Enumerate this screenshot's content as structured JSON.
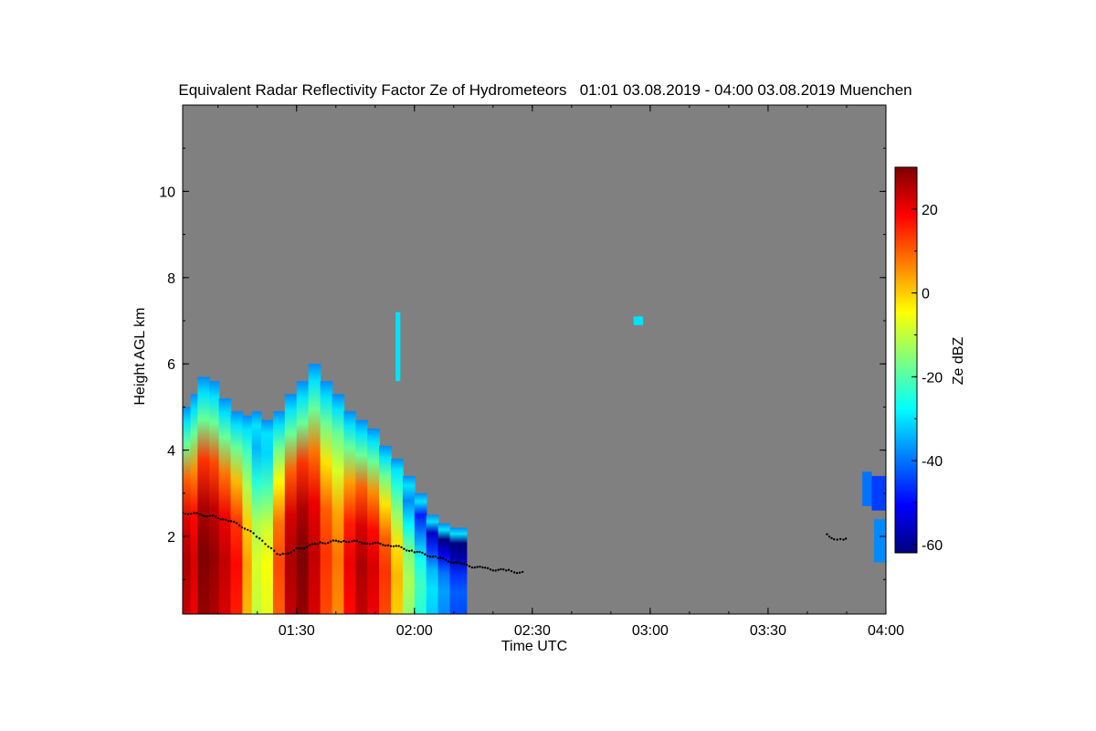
{
  "chart_data": {
    "type": "heatmap",
    "title": "Equivalent Radar Reflectivity Factor Ze of Hydrometeors   01:01 03.08.2019 - 04:00 03.08.2019 Muenchen",
    "xlabel": "Time UTC",
    "ylabel": "Height AGL km",
    "x_range_hours": [
      1.0167,
      4.0
    ],
    "y_range_km": [
      0.2,
      12.0
    ],
    "x_ticks": [
      {
        "value": 1.5,
        "label": "01:30"
      },
      {
        "value": 2.0,
        "label": "02:00"
      },
      {
        "value": 2.5,
        "label": "02:30"
      },
      {
        "value": 3.0,
        "label": "03:00"
      },
      {
        "value": 3.5,
        "label": "03:30"
      },
      {
        "value": 4.0,
        "label": "04:00"
      }
    ],
    "y_ticks": [
      {
        "value": 2,
        "label": "2"
      },
      {
        "value": 4,
        "label": "4"
      },
      {
        "value": 6,
        "label": "6"
      },
      {
        "value": 8,
        "label": "8"
      },
      {
        "value": 10,
        "label": "10"
      }
    ],
    "colorbar": {
      "label": "Ze dBZ",
      "range": [
        -62,
        30
      ],
      "ticks": [
        {
          "value": 20,
          "label": "20"
        },
        {
          "value": 0,
          "label": "0"
        },
        {
          "value": -20,
          "label": "-20"
        },
        {
          "value": -40,
          "label": "-40"
        },
        {
          "value": -60,
          "label": "-60"
        }
      ],
      "colors": [
        "#00007f",
        "#0000ff",
        "#007fff",
        "#00ffff",
        "#7fff7f",
        "#ffff00",
        "#ff7f00",
        "#ff0000",
        "#7f0000"
      ]
    },
    "background_color": "#808080",
    "echo_top_profile_km": [
      [
        1.0167,
        5.1
      ],
      [
        1.05,
        5.3
      ],
      [
        1.1,
        5.6
      ],
      [
        1.13,
        5.9
      ],
      [
        1.17,
        5.7
      ],
      [
        1.22,
        5.4
      ],
      [
        1.27,
        5.1
      ],
      [
        1.31,
        5.0
      ],
      [
        1.35,
        5.4
      ],
      [
        1.4,
        5.3
      ],
      [
        1.45,
        5.2
      ],
      [
        1.5,
        5.7
      ],
      [
        1.53,
        6.0
      ],
      [
        1.57,
        6.7
      ],
      [
        1.6,
        6.2
      ],
      [
        1.63,
        5.9
      ],
      [
        1.66,
        6.3
      ],
      [
        1.7,
        5.8
      ],
      [
        1.75,
        5.2
      ],
      [
        1.8,
        5.3
      ],
      [
        1.85,
        5.0
      ],
      [
        1.88,
        4.8
      ],
      [
        1.9,
        4.5
      ],
      [
        1.93,
        4.1
      ],
      [
        1.96,
        4.2
      ],
      [
        1.99,
        3.9
      ],
      [
        2.02,
        3.7
      ],
      [
        2.05,
        3.1
      ],
      [
        2.08,
        2.7
      ],
      [
        2.1,
        2.5
      ],
      [
        2.15,
        2.6
      ],
      [
        2.18,
        2.5
      ],
      [
        2.2,
        2.2
      ],
      [
        2.22,
        1.3
      ]
    ],
    "melting_layer_km": [
      [
        1.0167,
        2.55
      ],
      [
        1.1,
        2.5
      ],
      [
        1.2,
        2.4
      ],
      [
        1.28,
        2.2
      ],
      [
        1.33,
        2.0
      ],
      [
        1.38,
        1.75
      ],
      [
        1.43,
        1.55
      ],
      [
        1.5,
        1.7
      ],
      [
        1.6,
        1.85
      ],
      [
        1.7,
        1.9
      ],
      [
        1.8,
        1.85
      ],
      [
        1.9,
        1.8
      ],
      [
        2.0,
        1.65
      ],
      [
        2.1,
        1.5
      ],
      [
        2.2,
        1.35
      ],
      [
        2.3,
        1.25
      ],
      [
        2.4,
        1.2
      ],
      [
        2.47,
        1.15
      ]
    ],
    "melting_layer_late_km": [
      [
        3.75,
        2.05
      ],
      [
        3.78,
        1.95
      ],
      [
        3.82,
        1.95
      ],
      [
        3.84,
        1.98
      ]
    ],
    "cells": [
      {
        "t0": 1.0167,
        "t1": 1.05,
        "top": 5.0,
        "peak": 26
      },
      {
        "t0": 1.05,
        "t1": 1.08,
        "top": 5.3,
        "peak": 22
      },
      {
        "t0": 1.08,
        "t1": 1.13,
        "top": 5.7,
        "peak": 30
      },
      {
        "t0": 1.13,
        "t1": 1.17,
        "top": 5.6,
        "peak": 28
      },
      {
        "t0": 1.17,
        "t1": 1.22,
        "top": 5.2,
        "peak": 24
      },
      {
        "t0": 1.22,
        "t1": 1.27,
        "top": 4.9,
        "peak": 18
      },
      {
        "t0": 1.27,
        "t1": 1.31,
        "top": 4.8,
        "peak": 4
      },
      {
        "t0": 1.31,
        "t1": 1.35,
        "top": 4.9,
        "peak": -8
      },
      {
        "t0": 1.35,
        "t1": 1.4,
        "top": 4.7,
        "peak": -5
      },
      {
        "t0": 1.4,
        "t1": 1.45,
        "top": 4.9,
        "peak": 12
      },
      {
        "t0": 1.45,
        "t1": 1.5,
        "top": 5.3,
        "peak": 26
      },
      {
        "t0": 1.5,
        "t1": 1.55,
        "top": 5.6,
        "peak": 30
      },
      {
        "t0": 1.55,
        "t1": 1.6,
        "top": 6.0,
        "peak": 24
      },
      {
        "t0": 1.6,
        "t1": 1.65,
        "top": 5.6,
        "peak": 14
      },
      {
        "t0": 1.65,
        "t1": 1.7,
        "top": 5.3,
        "peak": 8
      },
      {
        "t0": 1.7,
        "t1": 1.75,
        "top": 4.9,
        "peak": 20
      },
      {
        "t0": 1.75,
        "t1": 1.8,
        "top": 4.7,
        "peak": 26
      },
      {
        "t0": 1.8,
        "t1": 1.85,
        "top": 4.5,
        "peak": 22
      },
      {
        "t0": 1.85,
        "t1": 1.9,
        "top": 4.1,
        "peak": 14
      },
      {
        "t0": 1.9,
        "t1": 1.95,
        "top": 3.8,
        "peak": 2
      },
      {
        "t0": 1.95,
        "t1": 2.0,
        "top": 3.4,
        "peak": -12
      },
      {
        "t0": 2.0,
        "t1": 2.05,
        "top": 3.0,
        "peak": -22
      },
      {
        "t0": 2.05,
        "t1": 2.1,
        "top": 2.5,
        "peak": -30
      },
      {
        "t0": 2.1,
        "t1": 2.15,
        "top": 2.3,
        "peak": -36
      },
      {
        "t0": 2.15,
        "t1": 2.22,
        "top": 2.2,
        "peak": -42
      }
    ],
    "late_echoes": [
      {
        "t0": 3.9,
        "t1": 3.94,
        "bottom": 2.7,
        "top": 3.5,
        "value": -40
      },
      {
        "t0": 3.94,
        "t1": 4.0,
        "bottom": 2.6,
        "top": 3.4,
        "value": -45
      },
      {
        "t0": 3.95,
        "t1": 4.0,
        "bottom": 1.4,
        "top": 2.4,
        "value": -38
      },
      {
        "t0": 2.93,
        "t1": 2.97,
        "bottom": 6.9,
        "top": 7.1,
        "value": -30
      }
    ],
    "isolated_echo": {
      "t0": 1.92,
      "t1": 1.94,
      "bottom": 5.6,
      "top": 7.2,
      "value": -30
    }
  }
}
